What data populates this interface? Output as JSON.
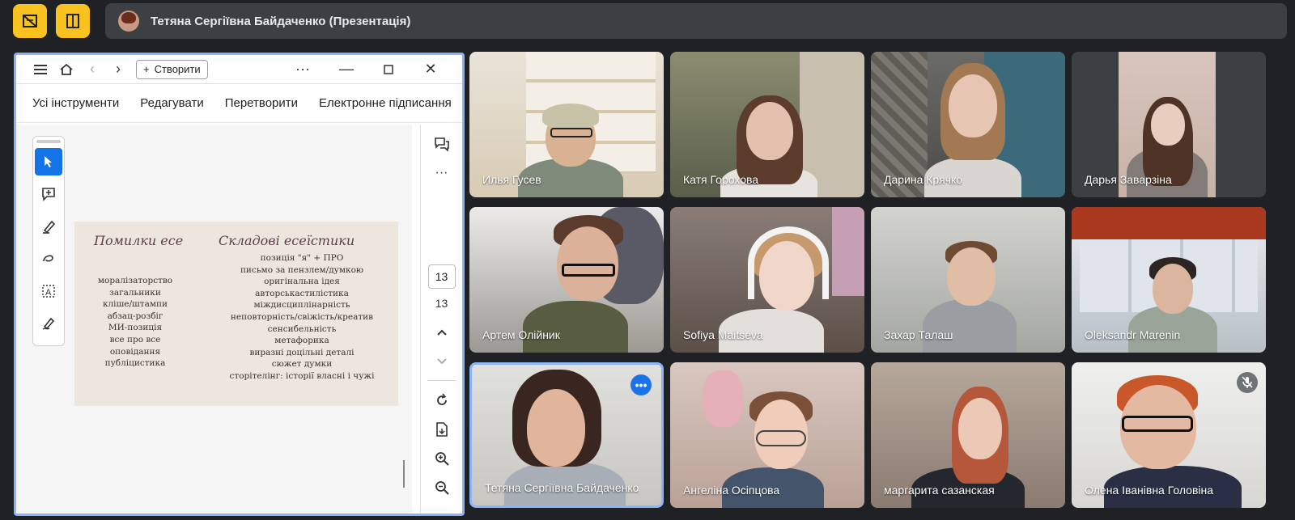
{
  "topbar": {
    "left_icons": [
      "hide-video-icon",
      "layout-icon"
    ],
    "presenter_title": "Тетяна Сергіївна Байдаченко (Презентація)"
  },
  "viewer": {
    "create_label": "Створити",
    "menu": [
      "Усі інструменти",
      "Редагувати",
      "Перетворити",
      "Електронне підписання"
    ],
    "page_current": "13",
    "page_total": "13"
  },
  "slide": {
    "heading_left": "Помилки есе",
    "heading_right": "Складові есеїстики",
    "left_items": [
      "моралізаторство",
      "загальники",
      "кліше/штампи",
      "абзац-розбіг",
      "МИ-позиція",
      "все про все",
      "оповідання",
      "публіцистика"
    ],
    "right_items": [
      "позиція \"я\" + ПРО",
      "письмо за пензлем/думкою",
      "оригінальна ідея",
      "авторськастилістика",
      "міждисциплінарність",
      "неповторність/свіжість/креатив",
      "сенсибельність",
      "метафорика",
      "виразні доцільні деталі",
      "сюжет думки",
      "сторітелінг: історії власні і чужі"
    ]
  },
  "participants": [
    {
      "name": "Илья Гусев"
    },
    {
      "name": "Катя Горохова"
    },
    {
      "name": "Дарина Крячко"
    },
    {
      "name": "Дарья Заварзіна"
    },
    {
      "name": "Артем Олійник"
    },
    {
      "name": "Sofiya Maitseva"
    },
    {
      "name": "Захар Талаш"
    },
    {
      "name": "Oleksandr Marenin"
    },
    {
      "name": "Тетяна Сергіївна Байдаченко"
    },
    {
      "name": "Ангеліна Осіпцова"
    },
    {
      "name": "маргарита сазанская"
    },
    {
      "name": "Олена Іванівна Головіна"
    }
  ]
}
